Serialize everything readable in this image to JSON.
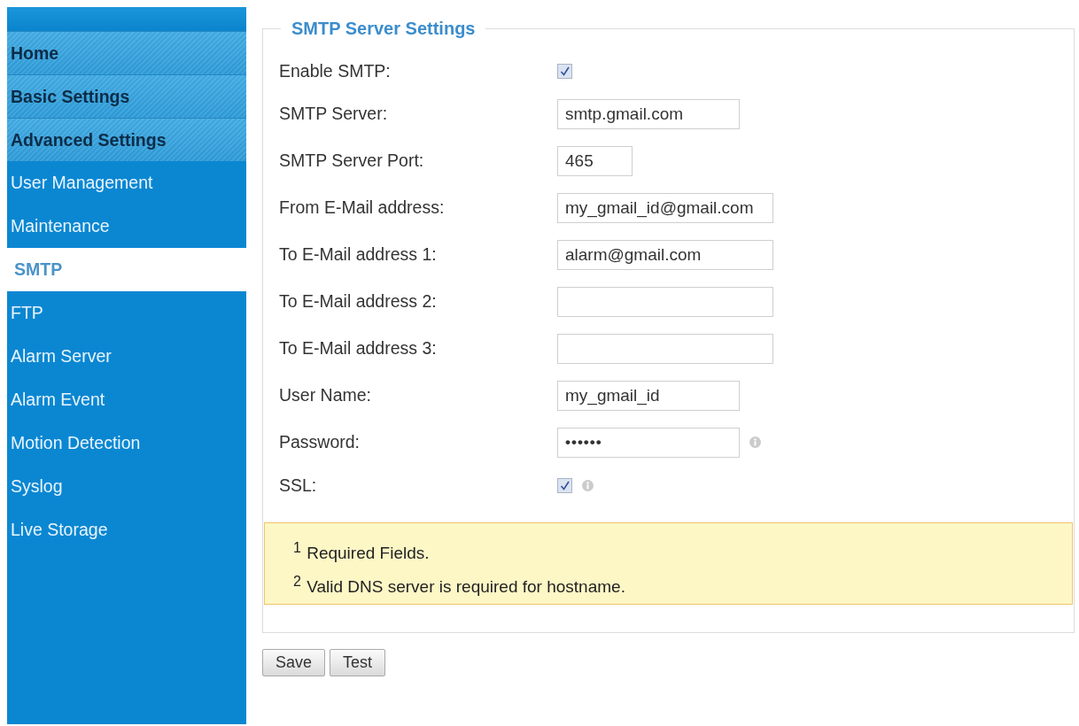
{
  "sidebar": {
    "items": [
      {
        "label": "Home",
        "kind": "section",
        "selected": false
      },
      {
        "label": "Basic Settings",
        "kind": "section",
        "selected": false
      },
      {
        "label": "Advanced Settings",
        "kind": "section",
        "selected": false
      },
      {
        "label": "User Management",
        "kind": "link",
        "selected": false
      },
      {
        "label": "Maintenance",
        "kind": "link",
        "selected": false
      },
      {
        "label": "SMTP",
        "kind": "link",
        "selected": true
      },
      {
        "label": "FTP",
        "kind": "link",
        "selected": false
      },
      {
        "label": "Alarm Server",
        "kind": "link",
        "selected": false
      },
      {
        "label": "Alarm Event",
        "kind": "link",
        "selected": false
      },
      {
        "label": "Motion Detection",
        "kind": "link",
        "selected": false
      },
      {
        "label": "Syslog",
        "kind": "link",
        "selected": false
      },
      {
        "label": "Live Storage",
        "kind": "link",
        "selected": false
      }
    ]
  },
  "panel": {
    "title": "SMTP Server Settings",
    "rows": [
      {
        "label": "Enable SMTP:",
        "kind": "checkbox",
        "checked": true,
        "info": false
      },
      {
        "label": "SMTP Server:",
        "kind": "text",
        "value": "smtp.gmail.com",
        "info": false
      },
      {
        "label": "SMTP Server Port:",
        "kind": "number",
        "value": "465",
        "info": false
      },
      {
        "label": "From E-Mail address:",
        "kind": "email",
        "value": "my_gmail_id@gmail.com",
        "info": false
      },
      {
        "label": "To E-Mail address 1:",
        "kind": "email",
        "value": "alarm@gmail.com",
        "info": false
      },
      {
        "label": "To E-Mail address 2:",
        "kind": "email",
        "info": false
      },
      {
        "label": "To E-Mail address 3:",
        "kind": "email",
        "info": false
      },
      {
        "label": "User Name:",
        "kind": "text",
        "value": "my_gmail_id",
        "info": false
      },
      {
        "label": "Password:",
        "kind": "password",
        "value": "••••••",
        "info": true
      },
      {
        "label": "SSL:",
        "kind": "checkbox",
        "checked": true,
        "info": true
      }
    ],
    "notes": [
      "$^{1}$ Required Fields.",
      "$^{2}$ Valid DNS server is required for hostname."
    ]
  },
  "buttons": [
    "Save",
    "Test"
  ]
}
